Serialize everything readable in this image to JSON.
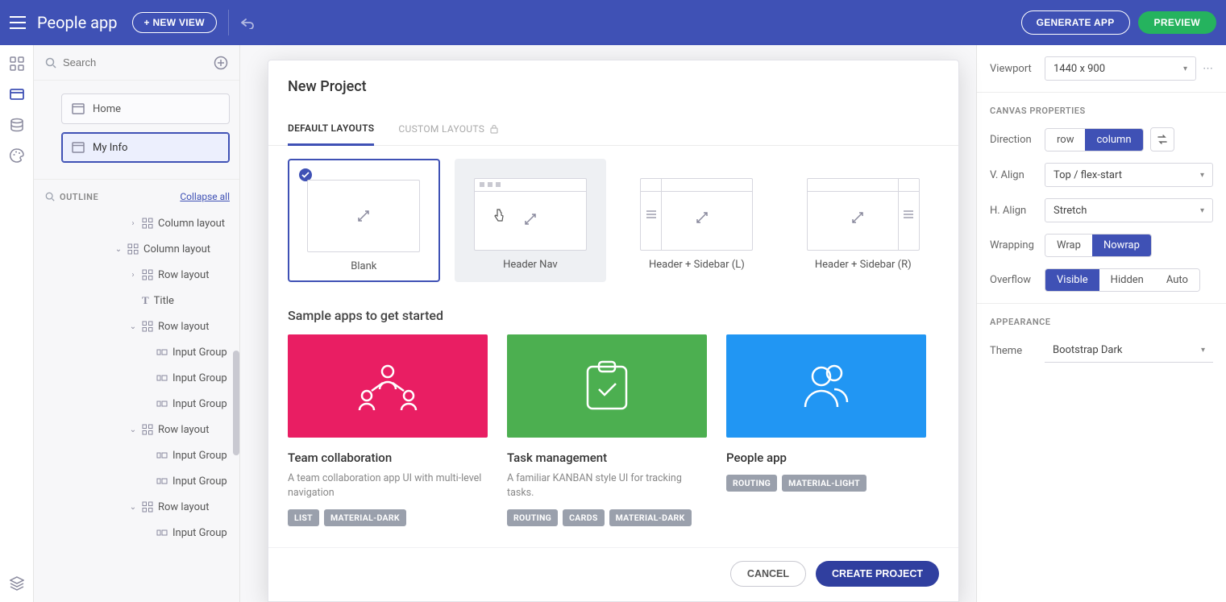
{
  "topbar": {
    "app_title": "People app",
    "new_view_label": "+ NEW VIEW",
    "generate_label": "GENERATE APP",
    "preview_label": "PREVIEW"
  },
  "leftpanel": {
    "search_placeholder": "Search",
    "views": [
      {
        "label": "Home",
        "active": false
      },
      {
        "label": "My Info",
        "active": true
      }
    ],
    "outline_label": "OUTLINE",
    "collapse_label": "Collapse all",
    "tree": [
      {
        "depth": 2,
        "chev": "›",
        "icon": "grid",
        "label": "Column layout"
      },
      {
        "depth": 1,
        "chev": "⌄",
        "icon": "grid",
        "label": "Column layout"
      },
      {
        "depth": 2,
        "chev": "›",
        "icon": "grid",
        "label": "Row layout"
      },
      {
        "depth": 2,
        "chev": "",
        "icon": "T",
        "label": "Title"
      },
      {
        "depth": 2,
        "chev": "⌄",
        "icon": "grid",
        "label": "Row layout"
      },
      {
        "depth": 3,
        "chev": "",
        "icon": "ig",
        "label": "Input Group"
      },
      {
        "depth": 3,
        "chev": "",
        "icon": "ig",
        "label": "Input Group"
      },
      {
        "depth": 3,
        "chev": "",
        "icon": "ig",
        "label": "Input Group"
      },
      {
        "depth": 2,
        "chev": "⌄",
        "icon": "grid",
        "label": "Row layout"
      },
      {
        "depth": 3,
        "chev": "",
        "icon": "ig",
        "label": "Input Group"
      },
      {
        "depth": 3,
        "chev": "",
        "icon": "ig",
        "label": "Input Group"
      },
      {
        "depth": 2,
        "chev": "⌄",
        "icon": "grid",
        "label": "Row layout"
      },
      {
        "depth": 3,
        "chev": "",
        "icon": "ig",
        "label": "Input Group"
      }
    ]
  },
  "rightpanel": {
    "viewport_label": "Viewport",
    "viewport_value": "1440 x 900",
    "canvas_section": "CANVAS PROPERTIES",
    "direction_label": "Direction",
    "direction_opts": [
      "row",
      "column"
    ],
    "direction_active": 1,
    "valign_label": "V. Align",
    "valign_value": "Top / flex-start",
    "halign_label": "H. Align",
    "halign_value": "Stretch",
    "wrapping_label": "Wrapping",
    "wrapping_opts": [
      "Wrap",
      "Nowrap"
    ],
    "wrapping_active": 1,
    "overflow_label": "Overflow",
    "overflow_opts": [
      "Visible",
      "Hidden",
      "Auto"
    ],
    "overflow_active": 0,
    "appearance_section": "APPEARANCE",
    "theme_label": "Theme",
    "theme_value": "Bootstrap Dark"
  },
  "modal": {
    "title": "New Project",
    "tabs": [
      {
        "label": "DEFAULT LAYOUTS",
        "active": true
      },
      {
        "label": "CUSTOM LAYOUTS",
        "locked": true
      }
    ],
    "layouts": [
      {
        "name": "Blank",
        "selected": true
      },
      {
        "name": "Header Nav",
        "hover": true
      },
      {
        "name": "Header + Sidebar (L)"
      },
      {
        "name": "Header + Sidebar (R)"
      }
    ],
    "sample_title": "Sample apps to get started",
    "samples": [
      {
        "name": "Team collaboration",
        "desc": "A team collaboration app UI with multi-level navigation",
        "color": "pink",
        "tags": [
          "LIST",
          "MATERIAL-DARK"
        ]
      },
      {
        "name": "Task management",
        "desc": "A familiar KANBAN style UI for tracking tasks.",
        "color": "green",
        "tags": [
          "ROUTING",
          "CARDS",
          "MATERIAL-DARK"
        ]
      },
      {
        "name": "People app",
        "desc": "",
        "color": "blue",
        "tags": [
          "ROUTING",
          "MATERIAL-LIGHT"
        ]
      }
    ],
    "cancel_label": "CANCEL",
    "create_label": "CREATE PROJECT"
  }
}
